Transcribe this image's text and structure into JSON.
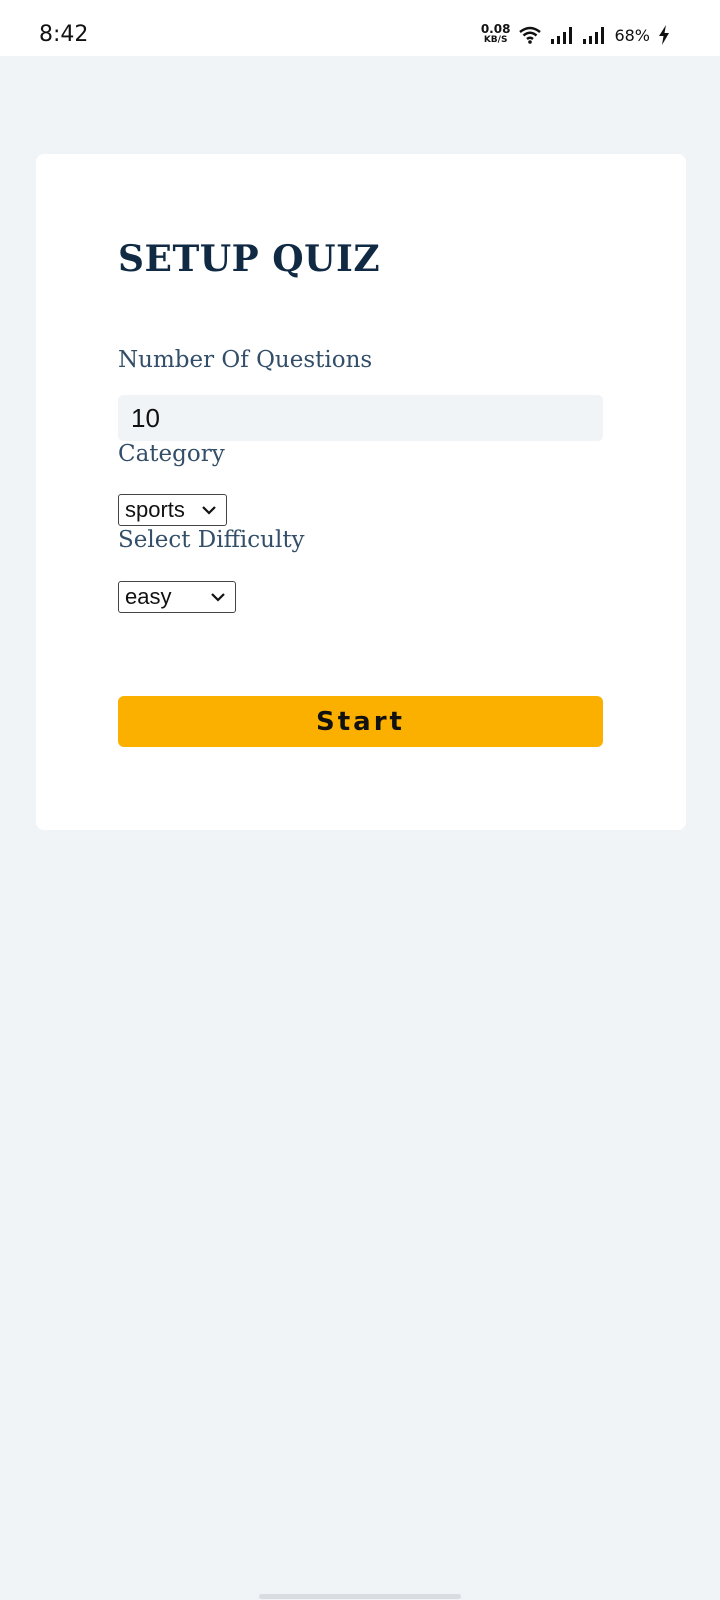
{
  "status_bar": {
    "time": "8:42",
    "net_speed_value": "0.08",
    "net_speed_unit": "KB/S",
    "battery": "68%",
    "icons": [
      "wifi-icon",
      "signal-icon",
      "signal-icon",
      "charging-icon"
    ]
  },
  "quiz_setup": {
    "title": "SETUP QUIZ",
    "questions_label": "Number Of Questions",
    "questions_value": "10",
    "category_label": "Category",
    "category_selected": "sports",
    "difficulty_label": "Select Difficulty",
    "difficulty_selected": "easy",
    "start_label": "Start"
  },
  "colors": {
    "background": "#f0f4f7",
    "card": "#ffffff",
    "title": "#102a43",
    "label": "#334e68",
    "accent": "#fbb000"
  }
}
